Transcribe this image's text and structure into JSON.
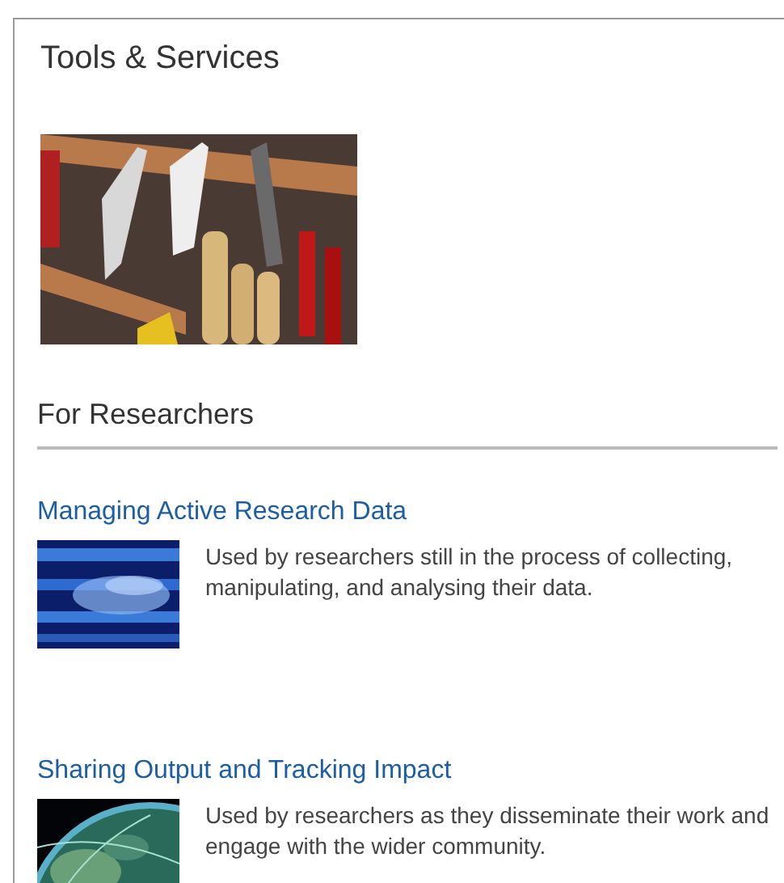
{
  "panel": {
    "title": "Tools & Services"
  },
  "section": {
    "heading": "For Researchers"
  },
  "services": [
    {
      "title": "Managing Active Research Data",
      "description": "Used by researchers still in the process of collecting, manipulating, and analysing their data.",
      "kind": "data"
    },
    {
      "title": "Sharing Output and Tracking Impact",
      "description": "Used by researchers as they disseminate their work and engage with the wider community.",
      "kind": "globe"
    }
  ]
}
